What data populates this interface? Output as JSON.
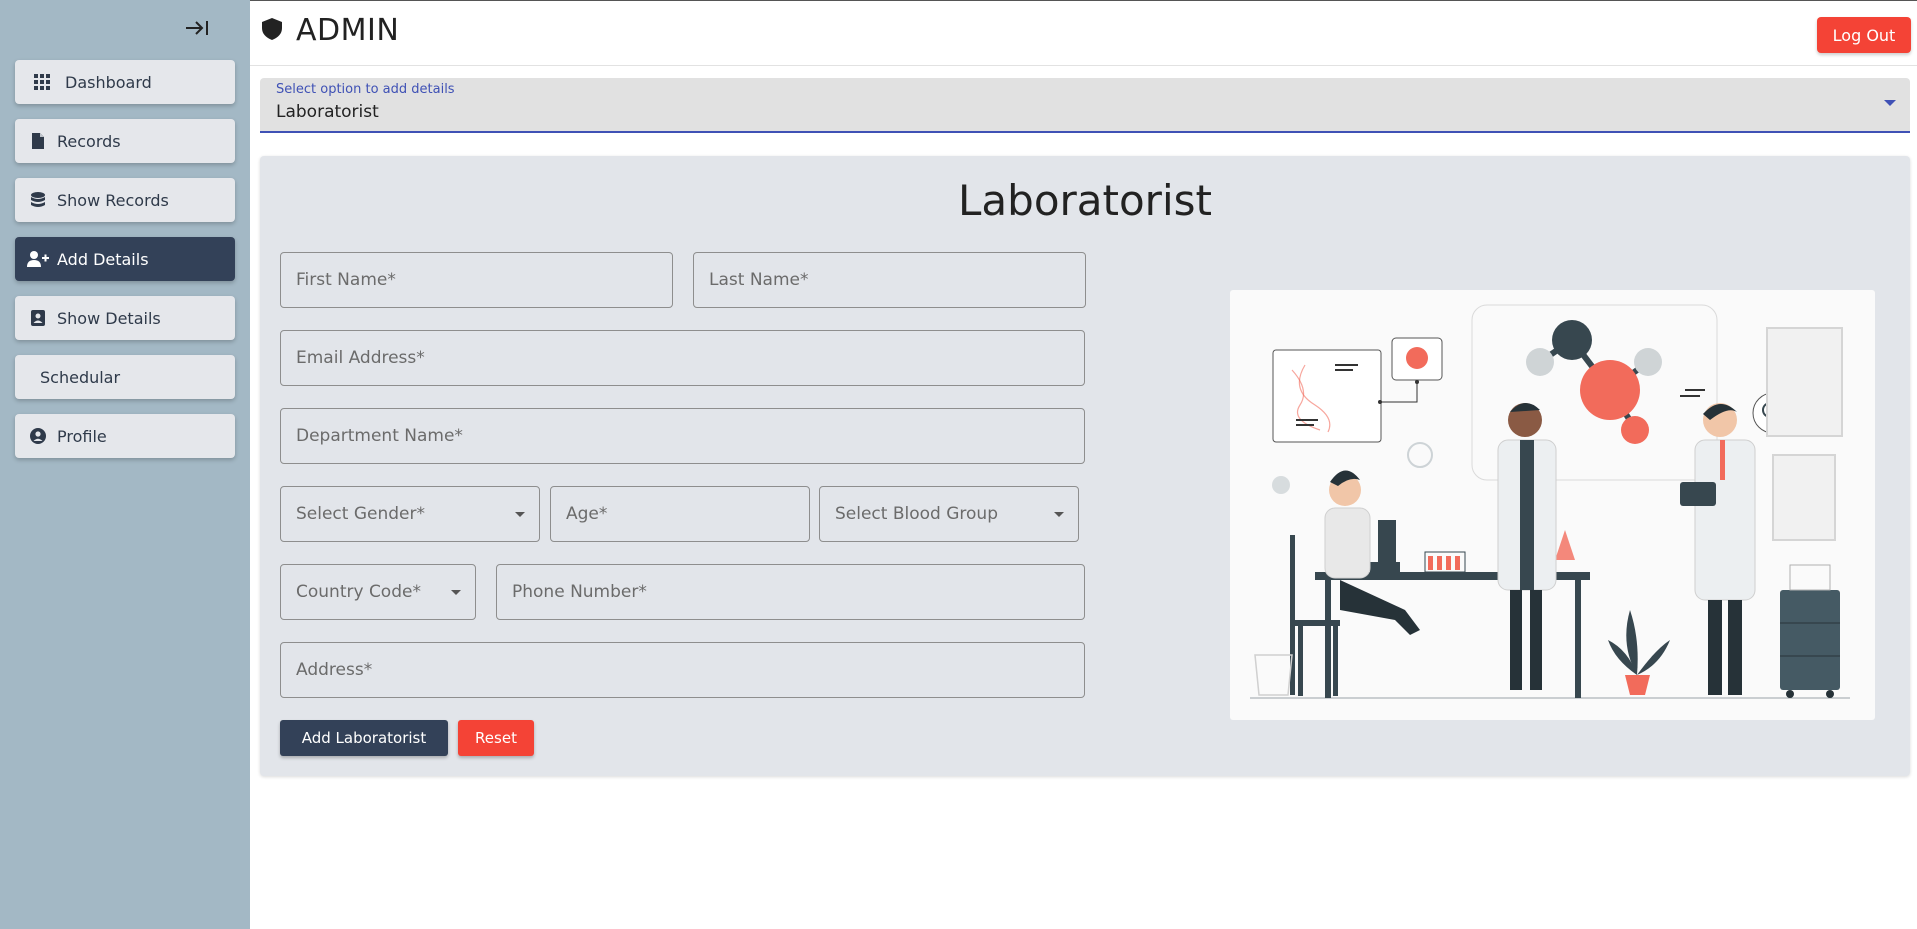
{
  "sidebar": {
    "items": [
      {
        "label": "Dashboard",
        "icon": "grid-icon"
      },
      {
        "label": "Records",
        "icon": "file-icon"
      },
      {
        "label": "Show Records",
        "icon": "database-icon"
      },
      {
        "label": "Add Details",
        "icon": "add-user-icon"
      },
      {
        "label": "Show Details",
        "icon": "contact-card-icon"
      },
      {
        "label": "Schedular",
        "icon": ""
      },
      {
        "label": "Profile",
        "icon": "account-circle-icon"
      }
    ],
    "active_index": 3
  },
  "header": {
    "title": "ADMIN",
    "logout_label": "Log Out"
  },
  "option_select": {
    "label": "Select option to add details",
    "value": "Laboratorist"
  },
  "form": {
    "title": "Laboratorist",
    "first_name_placeholder": "First Name*",
    "last_name_placeholder": "Last Name*",
    "email_placeholder": "Email Address*",
    "department_placeholder": "Department Name*",
    "gender_placeholder": "Select Gender*",
    "age_placeholder": "Age*",
    "blood_group_placeholder": "Select Blood Group",
    "country_code_placeholder": "Country Code*",
    "phone_placeholder": "Phone Number*",
    "address_placeholder": "Address*",
    "submit_label": "Add Laboratorist",
    "reset_label": "Reset"
  },
  "colors": {
    "sidebar_bg": "#a3b8c5",
    "nav_active": "#334158",
    "accent_red": "#f44336",
    "accent_coral": "#f26b5b",
    "dark_teal": "#37474f",
    "select_underline": "#3f51b5"
  }
}
